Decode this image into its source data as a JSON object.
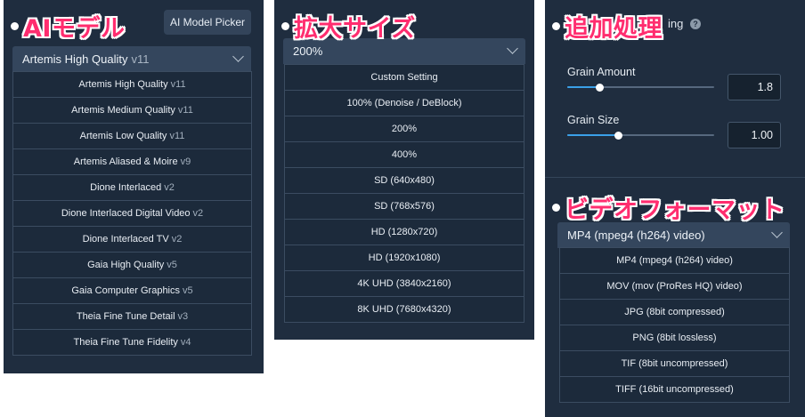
{
  "ai_model": {
    "tag": "AIモデル",
    "picker_button": "AI Model Picker",
    "selected": {
      "name": "Artemis High Quality",
      "version": "v11"
    },
    "options": [
      {
        "name": "Artemis High Quality",
        "version": "v11"
      },
      {
        "name": "Artemis Medium Quality",
        "version": "v11"
      },
      {
        "name": "Artemis Low Quality",
        "version": "v11"
      },
      {
        "name": "Artemis Aliased & Moire",
        "version": "v9"
      },
      {
        "name": "Dione Interlaced",
        "version": "v2"
      },
      {
        "name": "Dione Interlaced Digital Video",
        "version": "v2"
      },
      {
        "name": "Dione Interlaced TV",
        "version": "v2"
      },
      {
        "name": "Gaia High Quality",
        "version": "v5"
      },
      {
        "name": "Gaia Computer Graphics",
        "version": "v5"
      },
      {
        "name": "Theia Fine Tune Detail",
        "version": "v3"
      },
      {
        "name": "Theia Fine Tune Fidelity",
        "version": "v4"
      }
    ]
  },
  "size": {
    "tag": "拡大サイズ",
    "selected": "200%",
    "options": [
      "Custom Setting",
      "100% (Denoise / DeBlock)",
      "200%",
      "400%",
      "SD (640x480)",
      "SD (768x576)",
      "HD (1280x720)",
      "HD (1920x1080)",
      "4K UHD (3840x2160)",
      "8K UHD (7680x4320)"
    ]
  },
  "post": {
    "tag": "追加処理",
    "header_partial": "ing",
    "grain_amount": {
      "label": "Grain Amount",
      "value": "1.8",
      "level": 0.22
    },
    "grain_size": {
      "label": "Grain Size",
      "value": "1.00",
      "level": 0.35
    }
  },
  "format": {
    "tag": "ビデオフォーマット",
    "selected": "MP4 (mpeg4 (h264) video)",
    "options": [
      "MP4 (mpeg4 (h264) video)",
      "MOV (mov (ProRes HQ) video)",
      "JPG (8bit compressed)",
      "PNG (8bit lossless)",
      "TIF (8bit uncompressed)",
      "TIFF (16bit uncompressed)"
    ]
  },
  "colors": {
    "panel_bg": "#1f2d3f",
    "accent_blue": "#3aa0e8",
    "tag_pink": "#ff2d6f"
  }
}
